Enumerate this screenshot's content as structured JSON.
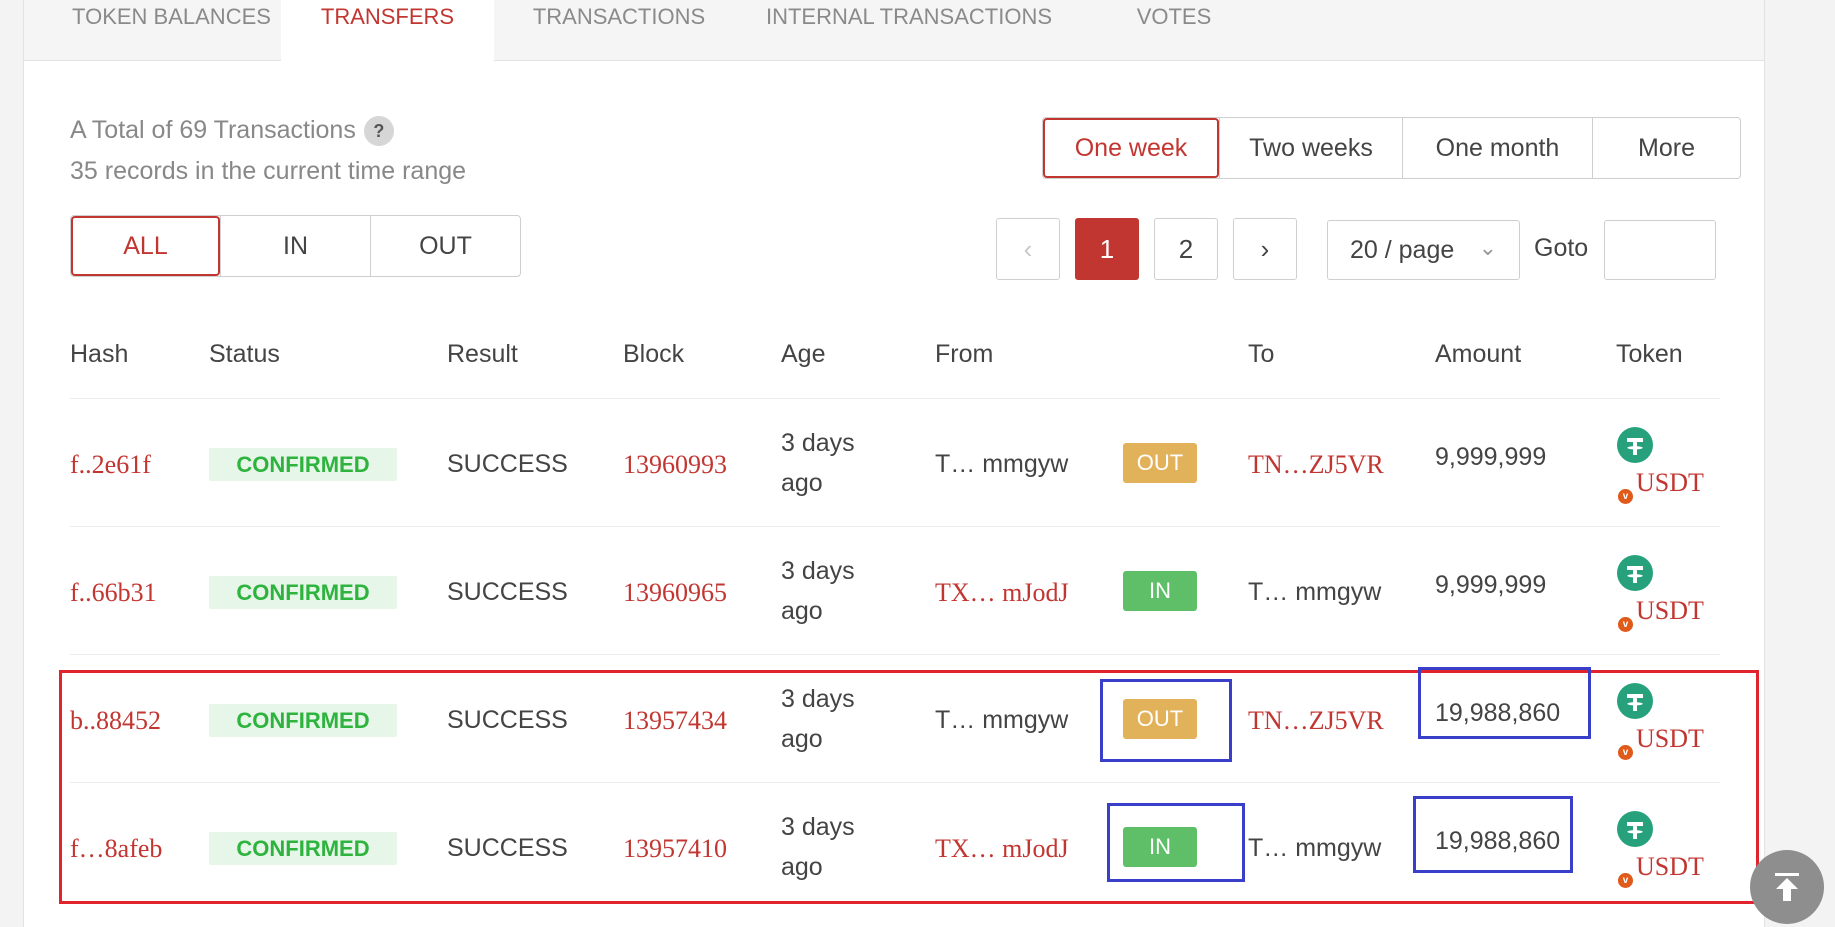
{
  "tabs": [
    {
      "label": "TOKEN BALANCES",
      "active": false
    },
    {
      "label": "TRANSFERS",
      "active": true
    },
    {
      "label": "TRANSACTIONS",
      "active": false
    },
    {
      "label": "INTERNAL TRANSACTIONS",
      "active": false
    },
    {
      "label": "VOTES",
      "active": false
    }
  ],
  "summary": {
    "total": "A Total of 69 Transactions",
    "help": "?",
    "records": "35 records in the current time range"
  },
  "time_range": {
    "options": [
      "One week",
      "Two weeks",
      "One month",
      "More"
    ],
    "selected": "One week"
  },
  "direction_filter": {
    "options": [
      "ALL",
      "IN",
      "OUT"
    ],
    "selected": "ALL"
  },
  "pagination": {
    "prev": "‹",
    "pages": [
      "1",
      "2"
    ],
    "current": "1",
    "next": "›",
    "page_size": "20 / page",
    "goto_label": "Goto",
    "goto_value": ""
  },
  "table": {
    "headers": [
      "Hash",
      "Status",
      "Result",
      "Block",
      "Age",
      "From",
      "To",
      "Amount",
      "Token"
    ],
    "rows": [
      {
        "hash": "f..2e61f",
        "status": "CONFIRMED",
        "result": "SUCCESS",
        "block": "13960993",
        "age_1": "3 days",
        "age_2": "ago",
        "from": "T… mmgyw",
        "direction": "OUT",
        "to": "TN…ZJ5VR",
        "amount": "9,999,999",
        "token": "USDT"
      },
      {
        "hash": "f..66b31",
        "status": "CONFIRMED",
        "result": "SUCCESS",
        "block": "13960965",
        "age_1": "3 days",
        "age_2": "ago",
        "from": "TX…  mJodJ",
        "direction": "IN",
        "to": "T… mmgyw",
        "amount": "9,999,999",
        "token": "USDT"
      },
      {
        "hash": "b..88452",
        "status": "CONFIRMED",
        "result": "SUCCESS",
        "block": "13957434",
        "age_1": "3 days",
        "age_2": "ago",
        "from": "T… mmgyw",
        "direction": "OUT",
        "to": "TN…ZJ5VR",
        "amount": "19,988,860",
        "token": "USDT"
      },
      {
        "hash": "f…8afeb",
        "status": "CONFIRMED",
        "result": "SUCCESS",
        "block": "13957410",
        "age_1": "3 days",
        "age_2": "ago",
        "from": "TX…  mJodJ",
        "direction": "IN",
        "to": "T… mmgyw",
        "amount": "19,988,860",
        "token": "USDT"
      }
    ]
  },
  "colors": {
    "accent": "#c23631",
    "confirmed_text": "#2fb33f",
    "out_badge": "#e2b25a",
    "in_badge": "#5fbf68",
    "highlight_red": "#e0232c",
    "highlight_blue": "#3a3fc9"
  },
  "icons": {
    "token": "tether-icon",
    "verified": "verified-icon",
    "back_to_top": "back-to-top-icon"
  }
}
